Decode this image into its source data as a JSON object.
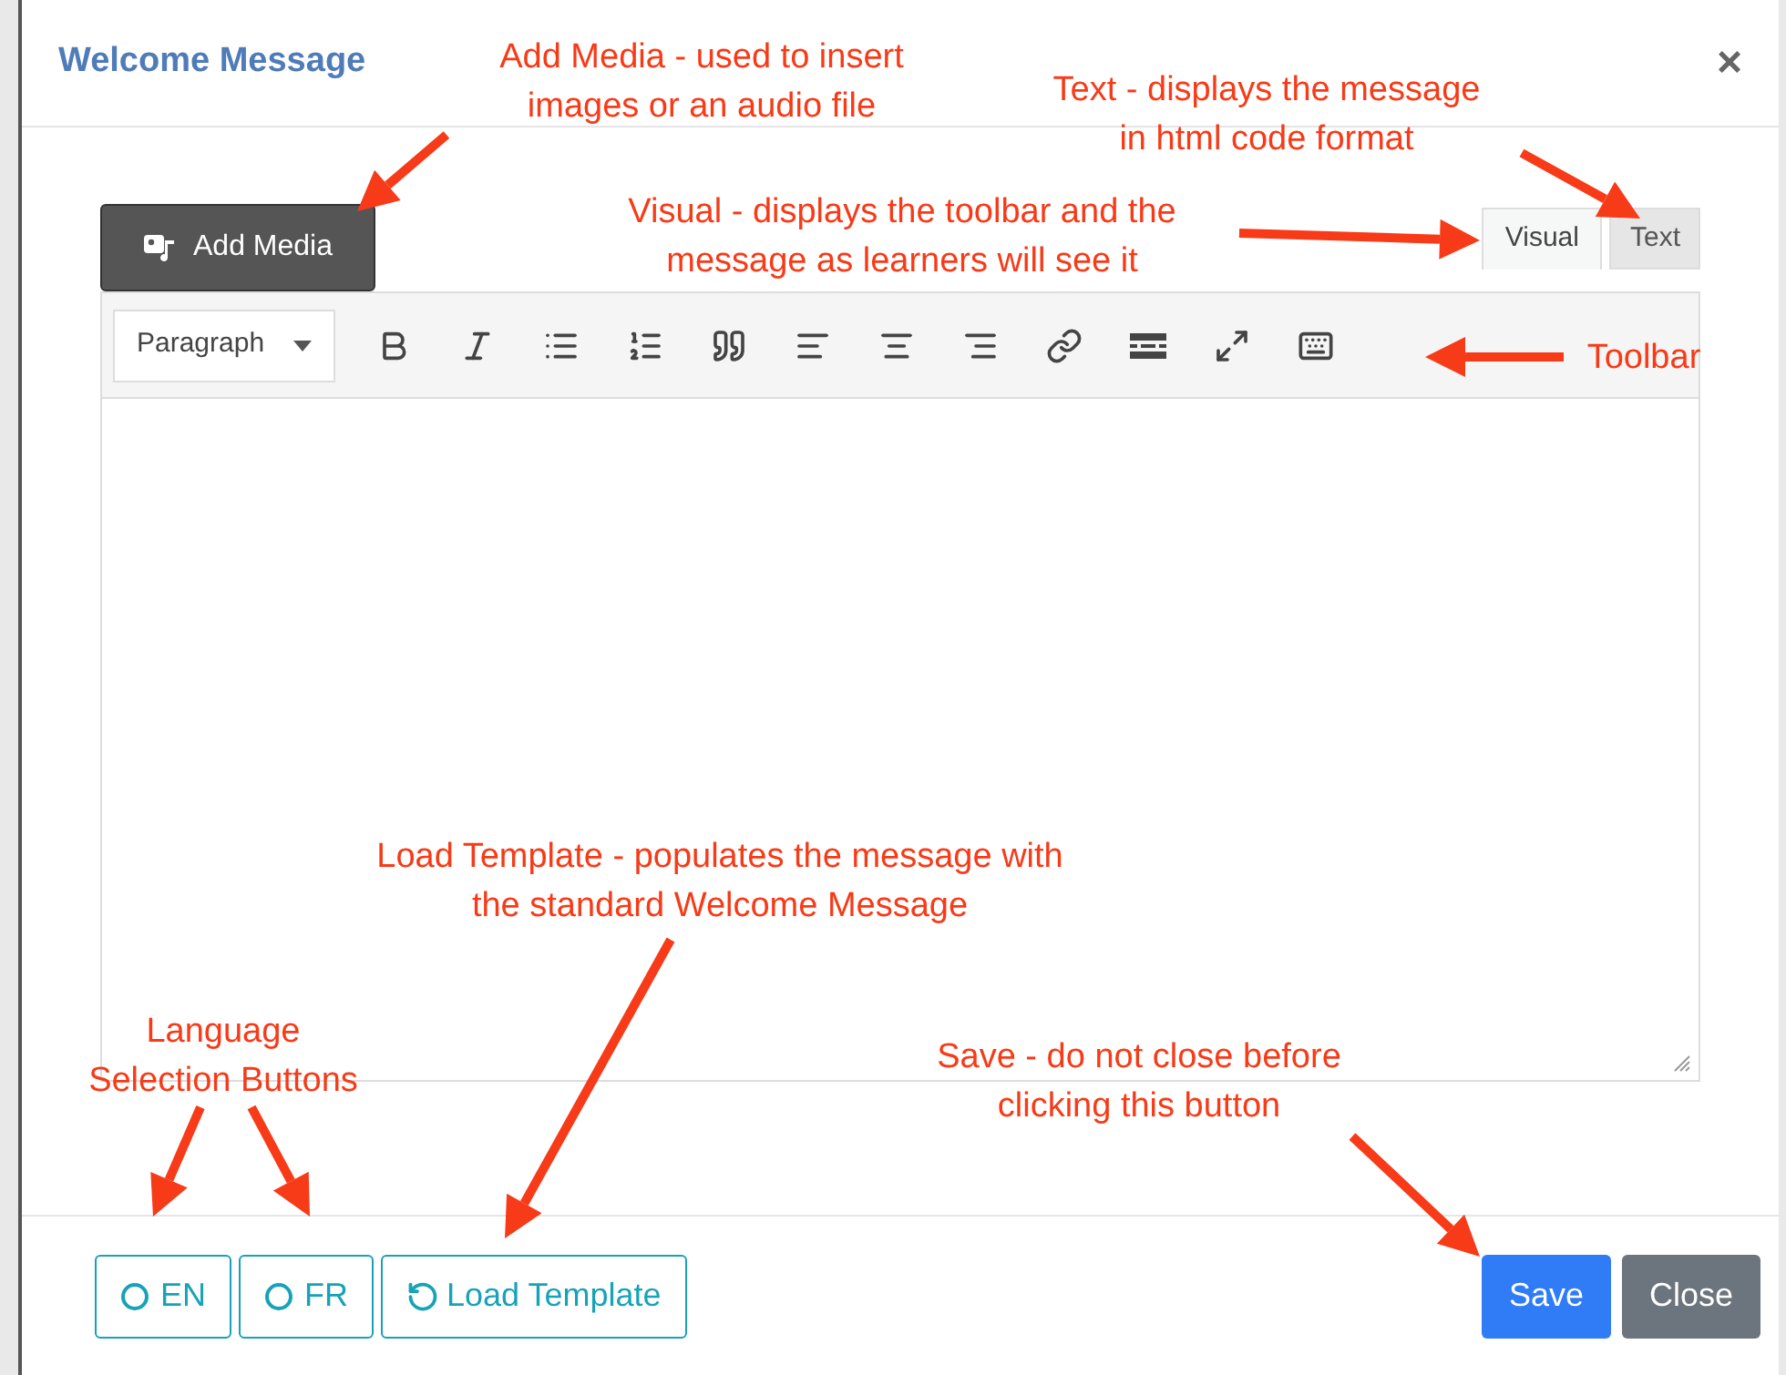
{
  "dialog": {
    "title": "Welcome Message",
    "close_symbol": "×"
  },
  "editor": {
    "add_media": "Add Media",
    "tabs": [
      {
        "label": "Visual",
        "selected": true
      },
      {
        "label": "Text",
        "selected": false
      }
    ],
    "format_select": "Paragraph"
  },
  "footer": {
    "languages": [
      {
        "label": "EN",
        "selected": false
      },
      {
        "label": "FR",
        "selected": false
      }
    ],
    "load_template": "Load Template",
    "save": "Save",
    "close": "Close"
  },
  "annotations": [
    {
      "lines": [
        "Add Media - used to insert",
        "images or an audio file"
      ]
    },
    {
      "lines": [
        "Text - displays the message",
        "in html code format"
      ]
    },
    {
      "lines": [
        "Visual - displays the toolbar and the",
        "message as learners will see it"
      ]
    },
    {
      "lines": [
        "Toolbar"
      ]
    },
    {
      "lines": [
        "Load Template - populates the message with",
        "the standard Welcome Message"
      ]
    },
    {
      "lines": [
        "Language",
        "Selection Buttons"
      ]
    },
    {
      "lines": [
        "Save - do not close before",
        "clicking this button"
      ]
    }
  ]
}
